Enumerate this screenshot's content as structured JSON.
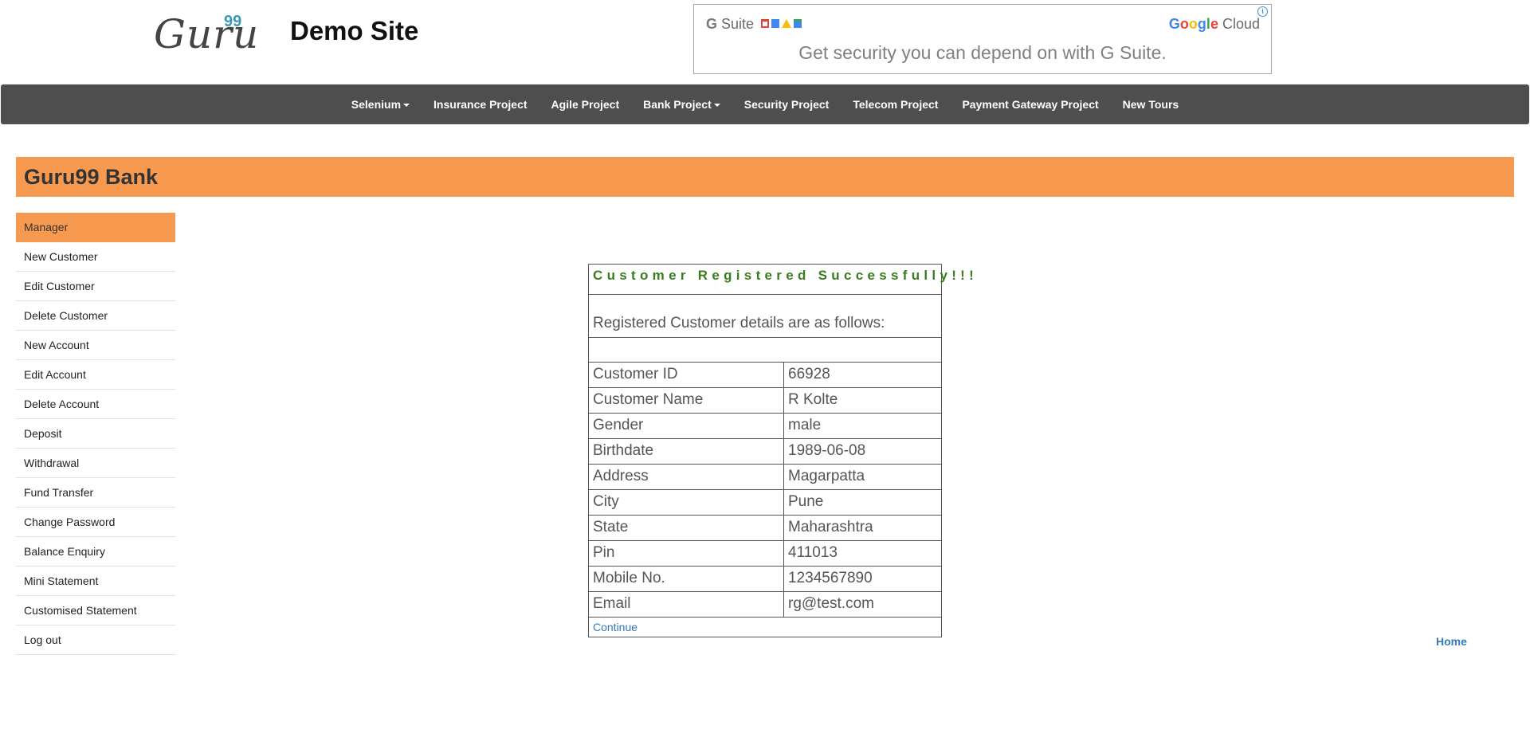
{
  "header": {
    "logo_text": "Guru",
    "logo_sup": "99",
    "site_title": "Demo Site"
  },
  "ad": {
    "brand": "Suite",
    "brand_g": "G",
    "cloud_google": "Google",
    "cloud_word": " Cloud",
    "info_icon": "info-icon",
    "tagline": "Get security you can depend on with G Suite.",
    "colors": {
      "google_blue": "#4285f4",
      "google_red": "#ea4335",
      "google_yellow": "#fbbc05",
      "google_green": "#34a853"
    }
  },
  "navbar": {
    "items": [
      {
        "label": "Selenium",
        "dropdown": true
      },
      {
        "label": "Insurance Project",
        "dropdown": false
      },
      {
        "label": "Agile Project",
        "dropdown": false
      },
      {
        "label": "Bank Project",
        "dropdown": true
      },
      {
        "label": "Security Project",
        "dropdown": false
      },
      {
        "label": "Telecom Project",
        "dropdown": false
      },
      {
        "label": "Payment Gateway Project",
        "dropdown": false
      },
      {
        "label": "New Tours",
        "dropdown": false
      }
    ],
    "color": "#4e4e4e"
  },
  "bank": {
    "title": "Guru99 Bank",
    "accent": "#f7994f"
  },
  "sidebar": {
    "items": [
      {
        "label": "Manager"
      },
      {
        "label": "New Customer"
      },
      {
        "label": "Edit Customer"
      },
      {
        "label": "Delete Customer"
      },
      {
        "label": "New Account"
      },
      {
        "label": "Edit Account"
      },
      {
        "label": "Delete Account"
      },
      {
        "label": "Deposit"
      },
      {
        "label": "Withdrawal"
      },
      {
        "label": "Fund Transfer"
      },
      {
        "label": "Change Password"
      },
      {
        "label": "Balance Enquiry"
      },
      {
        "label": "Mini Statement"
      },
      {
        "label": "Customised Statement"
      },
      {
        "label": "Log out"
      }
    ],
    "active": "Manager"
  },
  "details": {
    "heading": "Customer Registered Successfully!!!",
    "heading_color": "#3a7d1e",
    "subheading": "Registered Customer details are as follows:",
    "rows": [
      {
        "label": "Customer ID",
        "value": "66928"
      },
      {
        "label": "Customer Name",
        "value": "R Kolte"
      },
      {
        "label": "Gender",
        "value": "male"
      },
      {
        "label": "Birthdate",
        "value": "1989-06-08"
      },
      {
        "label": "Address",
        "value": "Magarpatta"
      },
      {
        "label": "City",
        "value": "Pune"
      },
      {
        "label": "State",
        "value": "Maharashtra"
      },
      {
        "label": "Pin",
        "value": "411013"
      },
      {
        "label": "Mobile No.",
        "value": "1234567890"
      },
      {
        "label": "Email",
        "value": "rg@test.com"
      }
    ],
    "continue_label": "Continue"
  },
  "footer": {
    "home_label": "Home"
  }
}
